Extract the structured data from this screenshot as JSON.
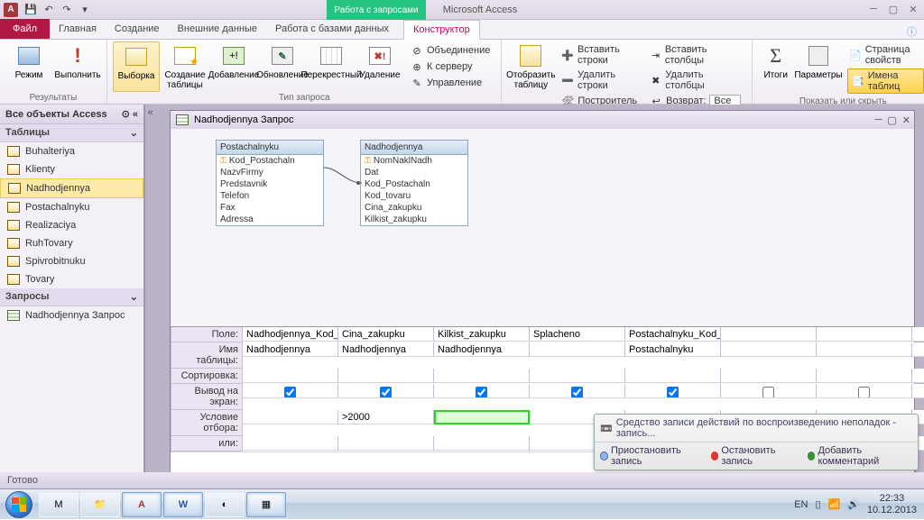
{
  "app": {
    "title": "Microsoft Access",
    "context_tab_group": "Работа с запросами"
  },
  "qat_icons": [
    "save",
    "undo",
    "redo",
    "dropdown"
  ],
  "tabs": {
    "file": "Файл",
    "items": [
      "Главная",
      "Создание",
      "Внешние данные",
      "Работа с базами данных"
    ],
    "context": "Конструктор"
  },
  "ribbon": {
    "results": {
      "label": "Результаты",
      "view": "Режим",
      "run": "Выполнить"
    },
    "query_type": {
      "label": "Тип запроса",
      "select": "Выборка",
      "make": "Создание таблицы",
      "append": "Добавление",
      "update": "Обновление",
      "crosstab": "Перекрестный",
      "delete": "Удаление",
      "union": "Объединение",
      "passthrough": "К серверу",
      "datadef": "Управление"
    },
    "setup": {
      "label": "Настройка запроса",
      "show_table": "Отобразить таблицу",
      "ins_rows": "Вставить строки",
      "del_rows": "Удалить строки",
      "builder": "Построитель",
      "ins_cols": "Вставить столбцы",
      "del_cols": "Удалить столбцы",
      "return": "Возврат:",
      "return_val": "Все"
    },
    "showhide": {
      "label": "Показать или скрыть",
      "totals": "Итоги",
      "params": "Параметры",
      "prop": "Страница свойств",
      "names": "Имена таблиц"
    }
  },
  "nav": {
    "header": "Все объекты Access",
    "cat_tables": "Таблицы",
    "tables": [
      "Buhalteriya",
      "Klienty",
      "Nadhodjennya",
      "Postachalnyku",
      "Realizaciya",
      "RuhTovary",
      "Spivrobitnuku",
      "Tovary"
    ],
    "cat_queries": "Запросы",
    "queries": [
      "Nadhodjennya Запрос"
    ]
  },
  "mdi": {
    "title": "Nadhodjennya Запрос"
  },
  "diagram": {
    "t1": {
      "name": "Postachalnyku",
      "fields": [
        "Kod_Postachaln",
        "NazvFirmy",
        "Predstavnik",
        "Telefon",
        "Fax",
        "Adressa"
      ],
      "pk": 0
    },
    "t2": {
      "name": "Nadhodjennya",
      "fields": [
        "NomNaklNadh",
        "Dat",
        "Kod_Postachaln",
        "Kod_tovaru",
        "Cina_zakupku",
        "Kilkist_zakupku"
      ],
      "pk": 0
    }
  },
  "grid": {
    "rows": [
      "Поле:",
      "Имя таблицы:",
      "Сортировка:",
      "Вывод на экран:",
      "Условие отбора:",
      "или:"
    ],
    "cols": [
      {
        "field": "Nadhodjennya_Kod_P",
        "table": "Nadhodjennya",
        "show": true,
        "crit": ""
      },
      {
        "field": "Cina_zakupku",
        "table": "Nadhodjennya",
        "show": true,
        "crit": ">2000"
      },
      {
        "field": "Kilkist_zakupku",
        "table": "Nadhodjennya",
        "show": true,
        "crit": "",
        "active": true
      },
      {
        "field": "Splacheno",
        "table": "",
        "show": true,
        "crit": ""
      },
      {
        "field": "Postachalnyku_Kod_P",
        "table": "Postachalnyku",
        "show": true,
        "crit": ""
      },
      {
        "field": "",
        "table": "",
        "show": false,
        "crit": ""
      },
      {
        "field": "",
        "table": "",
        "show": false,
        "crit": ""
      },
      {
        "field": "",
        "table": "",
        "show": false,
        "crit": ""
      }
    ]
  },
  "status": "Готово",
  "recorder": {
    "title": "Средство записи действий по воспроизведению неполадок - запись...",
    "pause": "Приостановить запись",
    "stop": "Остановить запись",
    "comment": "Добавить комментарий"
  },
  "tray": {
    "lang": "EN",
    "time": "22:33",
    "date": "10.12.2013"
  }
}
